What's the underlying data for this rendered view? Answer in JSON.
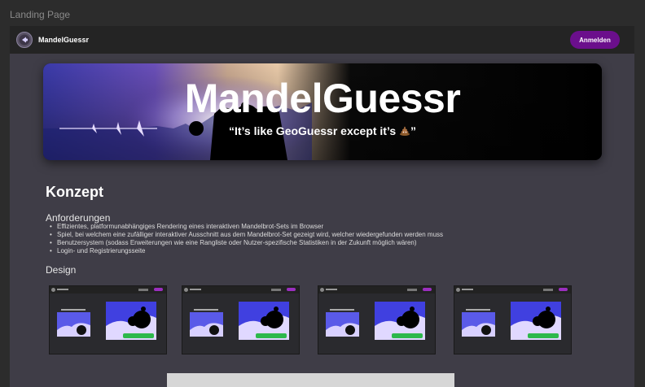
{
  "frame": {
    "label": "Landing Page"
  },
  "header": {
    "brand": "MandelGuessr",
    "login_label": "Anmelden",
    "logo_icon": "mandelbrot-logo-icon"
  },
  "hero": {
    "title": "MandelGuessr",
    "subtitle_before": "“It’s like GeoGuessr except it’s ",
    "subtitle_after": "”",
    "emoji_icon": "poop-emoji-icon"
  },
  "concept": {
    "title": "Konzept",
    "requirements_title": "Anforderungen",
    "requirements": [
      "Effizientes, platformunabhängiges Rendering eines interaktiven Mandelbrot-Sets im Browser",
      "Spiel, bei welchem eine zufälliger interaktiver Ausschnitt aus dem Mandelbrot-Set gezeigt wird, welcher wiedergefunden werden muss",
      "Benutzersystem (sodass Erweiterungen wie eine Rangliste oder Nutzer-spezifische Statistiken in der Zukunft möglich wären)",
      "Login- und Registrierungsseite"
    ],
    "design_title": "Design"
  },
  "colors": {
    "page_bg": "#2c2c2c",
    "frame_bg": "#3f3d47",
    "topbar_bg": "#242424",
    "accent": "#6b0f8c"
  }
}
